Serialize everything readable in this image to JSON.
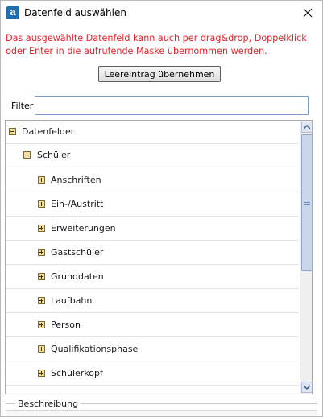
{
  "window": {
    "app_icon_letter": "a",
    "title": "Datenfeld auswählen"
  },
  "hint": "Das ausgewählte Datenfeld kann auch per drag&drop, Doppelklick oder Enter in die aufrufende Maske übernommen werden.",
  "leer_button": "Leereintrag übernehmen",
  "filter": {
    "label": "Filter",
    "value": ""
  },
  "tree": {
    "root": {
      "label": "Datenfelder",
      "state": "expanded"
    },
    "group": {
      "label": "Schüler",
      "state": "expanded"
    },
    "items": [
      {
        "label": "Anschriften"
      },
      {
        "label": "Ein-/Austritt"
      },
      {
        "label": "Erweiterungen"
      },
      {
        "label": "Gastschüler"
      },
      {
        "label": "Grunddaten"
      },
      {
        "label": "Laufbahn"
      },
      {
        "label": "Person"
      },
      {
        "label": "Qualifikationsphase"
      },
      {
        "label": "Schülerkopf"
      }
    ]
  },
  "description": {
    "label": "Beschreibung"
  },
  "colors": {
    "hint_text": "#e0242a",
    "expander_fill": "#f3df9a",
    "scroll_thumb": "#c9d7ec"
  },
  "icons": {
    "close": "close-icon",
    "expand": "plus-box-icon",
    "collapse": "minus-box-icon"
  }
}
